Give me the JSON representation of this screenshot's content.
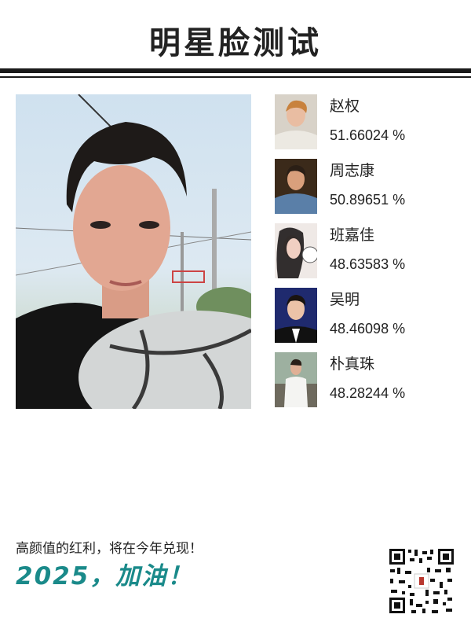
{
  "header": {
    "title": "明星脸测试"
  },
  "matches": [
    {
      "name": "赵权",
      "score": "51.66024 %",
      "avatar_icon": "celebrity-photo"
    },
    {
      "name": "周志康",
      "score": "50.89651 %",
      "avatar_icon": "celebrity-photo"
    },
    {
      "name": "班嘉佳",
      "score": "48.63583 %",
      "avatar_icon": "celebrity-photo"
    },
    {
      "name": "吴明",
      "score": "48.46098 %",
      "avatar_icon": "celebrity-photo"
    },
    {
      "name": "朴真珠",
      "score": "48.28244 %",
      "avatar_icon": "celebrity-photo"
    }
  ],
  "footer": {
    "slogan": "高颜值的红利，将在今年兑现！",
    "cheer": "2025，加油！",
    "qr_icon": "qr-code"
  },
  "colors": {
    "accent": "#1a8a8a",
    "rule": "#1a1a1a"
  }
}
